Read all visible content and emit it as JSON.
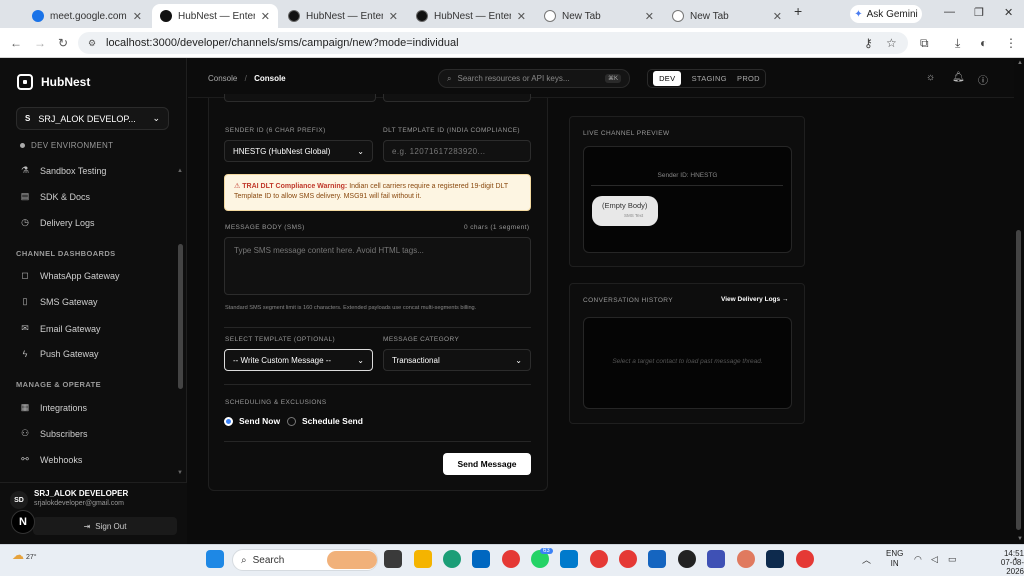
{
  "browser": {
    "tabs": [
      {
        "title": "meet.google.com",
        "fav": "#1a73e8"
      },
      {
        "title": "HubNest — Enterprise",
        "fav": "#111"
      },
      {
        "title": "HubNest — Enterprise",
        "fav": "#111"
      },
      {
        "title": "HubNest — Enterprise",
        "fav": "#111"
      },
      {
        "title": "New Tab",
        "fav": "#555"
      },
      {
        "title": "New Tab",
        "fav": "#555"
      }
    ],
    "gemini_label": "Ask Gemini",
    "url": "localhost:3000/developer/channels/sms/campaign/new?mode=individual"
  },
  "sidebar": {
    "brand": "HubNest",
    "workspace_initial": "S",
    "workspace_name": "SRJ_ALOK DEVELOP...",
    "environment": "DEV ENVIRONMENT",
    "top_items": [
      {
        "label": "Sandbox Testing",
        "icon": "flask-icon"
      },
      {
        "label": "SDK & Docs",
        "icon": "book-icon"
      },
      {
        "label": "Delivery Logs",
        "icon": "clock-icon"
      }
    ],
    "section_channels": "CHANNEL DASHBOARDS",
    "channel_items": [
      {
        "label": "WhatsApp Gateway",
        "icon": "chat-icon"
      },
      {
        "label": "SMS Gateway",
        "icon": "phone-icon"
      },
      {
        "label": "Email Gateway",
        "icon": "mail-icon"
      },
      {
        "label": "Push Gateway",
        "icon": "bolt-icon"
      }
    ],
    "section_manage": "MANAGE & OPERATE",
    "manage_items": [
      {
        "label": "Integrations",
        "icon": "grid-icon"
      },
      {
        "label": "Subscribers",
        "icon": "user-icon"
      },
      {
        "label": "Webhooks",
        "icon": "link-icon"
      }
    ],
    "user": {
      "initials": "SD",
      "name": "SRJ_ALOK DEVELOPER",
      "email": "srjalokdeveloper@gmail.com",
      "sign_out": "Sign Out"
    }
  },
  "header": {
    "crumb_root": "Console",
    "crumb_sep": "/",
    "crumb_current": "Console",
    "search_placeholder": "Search resources or API keys...",
    "search_kbd": "⌘K",
    "env_tabs": [
      "DEV",
      "STAGING",
      "PROD"
    ],
    "active_env": "DEV"
  },
  "form": {
    "sender_label": "SENDER ID (6 CHAR PREFIX)",
    "sender_value": "HNESTG (HubNest Global)",
    "dlt_label": "DLT TEMPLATE ID (INDIA COMPLIANCE)",
    "dlt_placeholder": "e.g. 12071617283920...",
    "warning_title": "TRAI DLT Compliance Warning:",
    "warning_text": "Indian cell carriers require a registered 19-digit DLT Template ID to allow SMS delivery. MSG91 will fail without it.",
    "body_label": "MESSAGE BODY (SMS)",
    "body_count": "0 chars (1 segment)",
    "body_placeholder": "Type SMS message content here. Avoid HTML tags...",
    "body_hint": "Standard SMS segment limit is 160 characters. Extended payloads use concat multi-segments billing.",
    "template_label": "SELECT TEMPLATE (OPTIONAL)",
    "template_value": "-- Write Custom Message --",
    "category_label": "MESSAGE CATEGORY",
    "category_value": "Transactional",
    "schedule_label": "SCHEDULING & EXCLUSIONS",
    "send_now": "Send Now",
    "schedule_send": "Schedule Send",
    "send_button": "Send Message"
  },
  "preview": {
    "title": "LIVE CHANNEL PREVIEW",
    "sender_line": "Sender ID: HNESTG",
    "bubble_text": "(Empty Body)",
    "bubble_meta": "SMS Text"
  },
  "history": {
    "title": "CONVERSATION HISTORY",
    "link": "View Delivery Logs →",
    "empty": "Select a target contact to load past message thread."
  },
  "taskbar": {
    "weather": "27°",
    "search": "Search",
    "badge": "63",
    "lang1": "ENG",
    "lang2": "IN",
    "time": "14:51",
    "date": "07-08-2026"
  }
}
